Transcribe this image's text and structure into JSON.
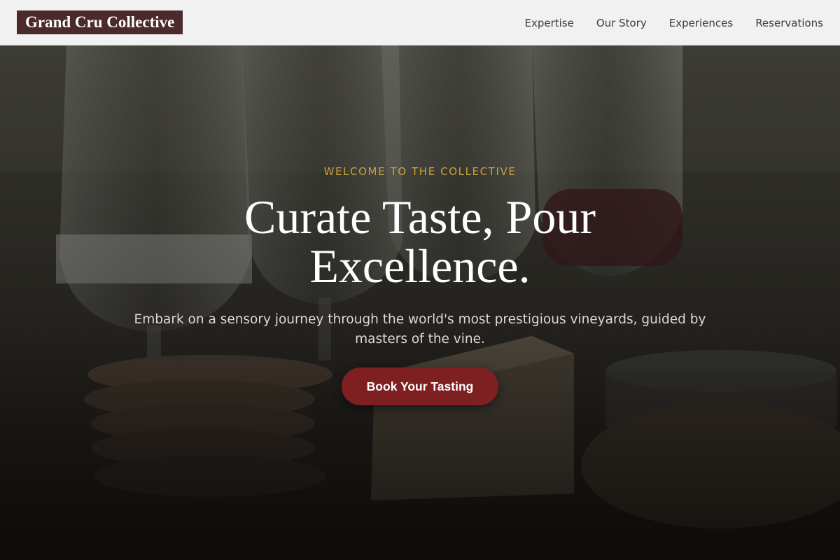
{
  "brand": {
    "name": "Grand Cru Collective"
  },
  "nav": {
    "items": [
      {
        "label": "Expertise"
      },
      {
        "label": "Our Story"
      },
      {
        "label": "Experiences"
      },
      {
        "label": "Reservations"
      }
    ]
  },
  "hero": {
    "eyebrow": "WELCOME TO THE COLLECTIVE",
    "headline": "Curate Taste, Pour Excellence.",
    "subtext": "Embark on a sensory journey through the world's most prestigious vineyards, guided by masters of the vine.",
    "cta_label": "Book Your Tasting",
    "background_image": "wine glasses with crackers and cheese"
  },
  "colors": {
    "header_bg": "#f1f1f1",
    "logo_bg": "#4a2a2a",
    "accent_gold": "#c9a03c",
    "cta_bg": "#7e1f22"
  }
}
